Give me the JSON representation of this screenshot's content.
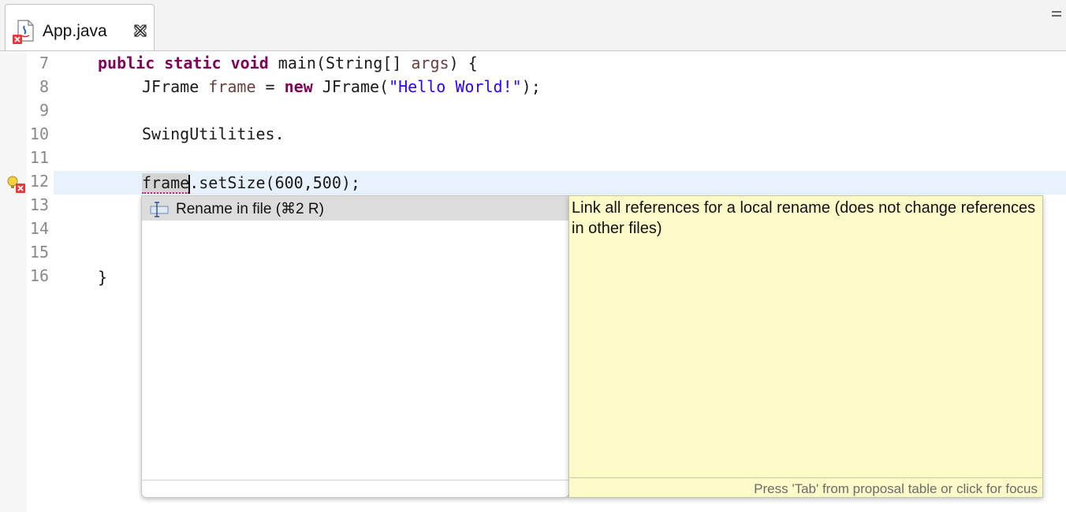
{
  "tab": {
    "label": "App.java",
    "icon": "java-file-error-icon",
    "close_icon": "close-icon"
  },
  "gutter": {
    "lines": [
      "7",
      "8",
      "9",
      "10",
      "11",
      "12",
      "13",
      "14",
      "15",
      "16"
    ],
    "error_line": "12"
  },
  "code": {
    "line7": {
      "kw1": "public",
      "kw2": "static",
      "kw3": "void",
      "t1": " main(String[] ",
      "var": "args",
      "t2": ") {"
    },
    "line8": {
      "t1": "JFrame ",
      "var": "frame",
      "t2": " = ",
      "kw": "new",
      "t3": " JFrame(",
      "str": "\"Hello World!\"",
      "t4": ");"
    },
    "line10": {
      "t1": "SwingUtilities."
    },
    "line12": {
      "ref": "frame",
      "t1": ".setSize(600,500);"
    },
    "line16": {
      "t1": "}"
    }
  },
  "quick_assist": {
    "proposal_label": "Rename in file (⌘2 R)",
    "proposal_icon": "rename-icon"
  },
  "info_popup": {
    "description": "Link all references for a local rename (does not change references in other files)",
    "footer_hint": "Press 'Tab' from proposal table or click for focus"
  },
  "colors": {
    "keyword": "#7f0055",
    "string": "#2a00ff",
    "variable": "#6a3e3e",
    "current_line": "#e8f2fe",
    "info_background": "#fbfac8"
  }
}
